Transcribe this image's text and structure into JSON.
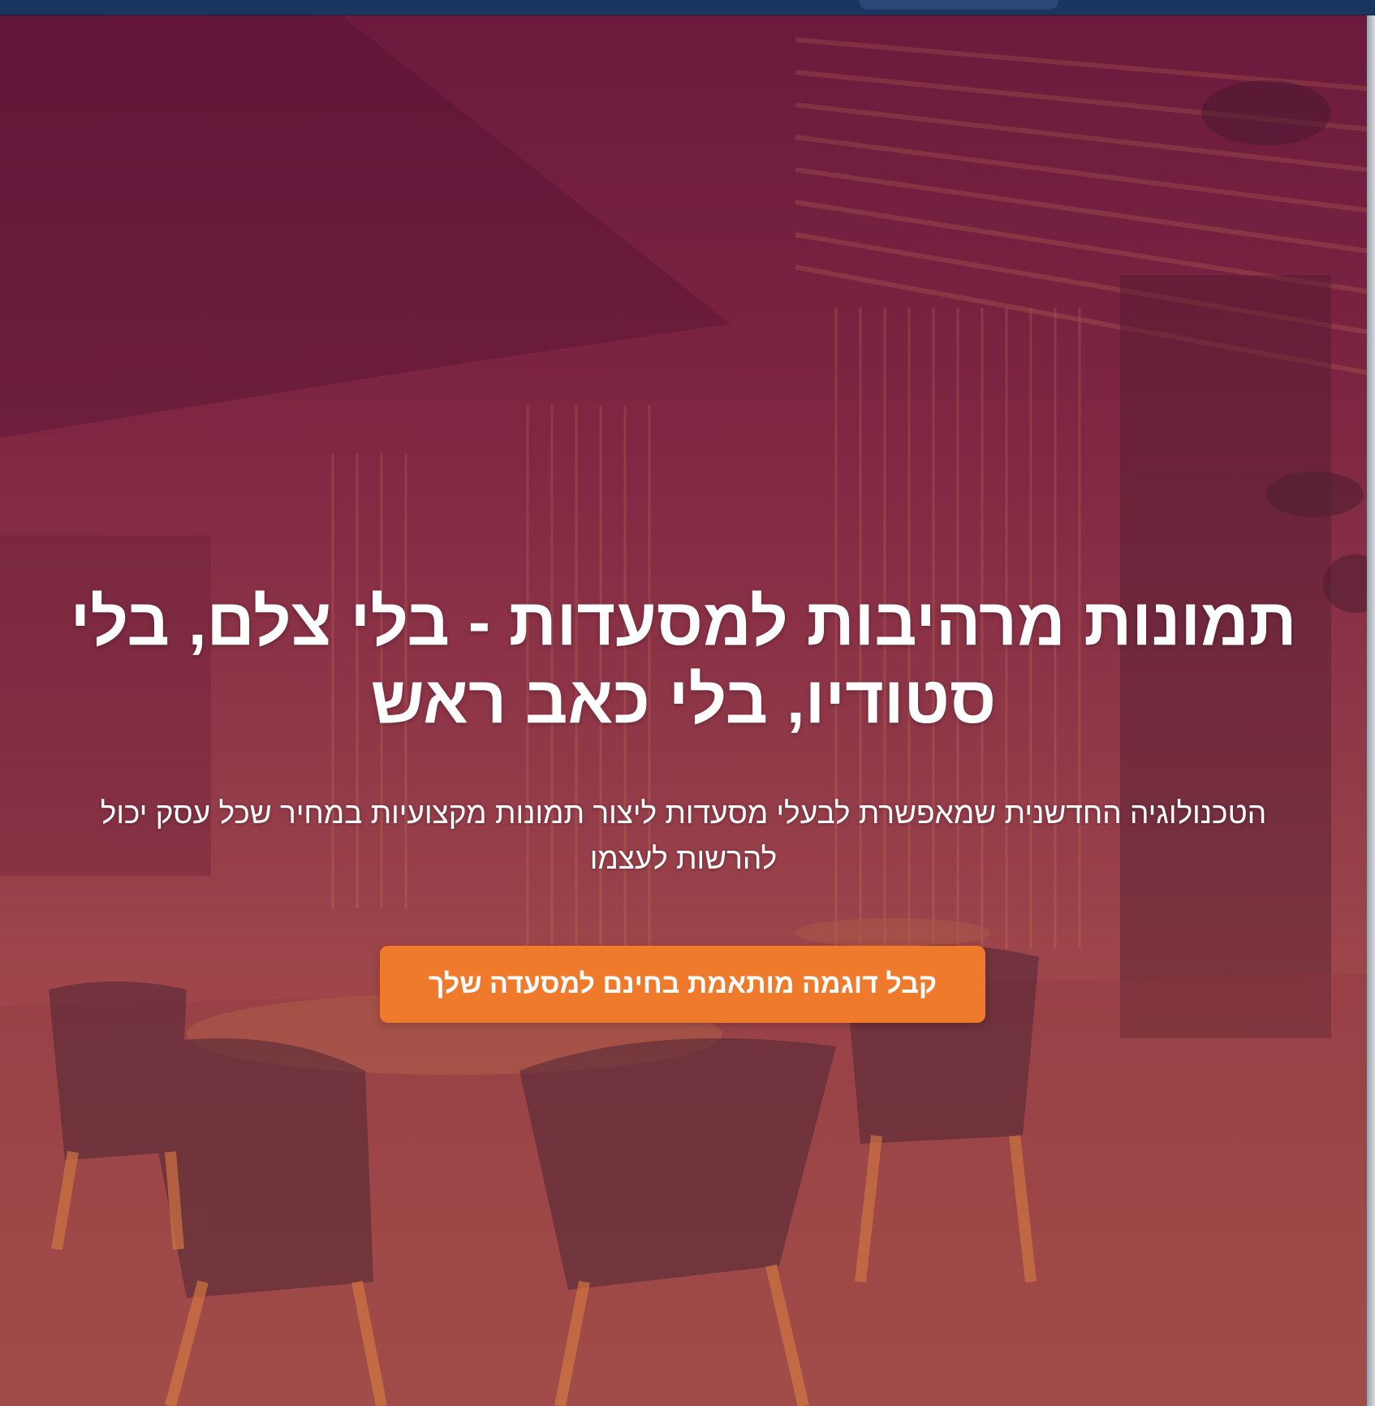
{
  "hero": {
    "headline": "תמונות מרהיבות למסעדות - בלי צלם, בלי סטודיו, בלי כאב ראש",
    "subtext": "הטכנולוגיה החדשנית שמאפשרת לבעלי מסעדות ליצור תמונות מקצועיות במחיר שכל עסק יכול להרשות לעצמו",
    "cta_label": "קבל דוגמה מותאמת בחינם למסעדה שלך"
  },
  "colors": {
    "topbar": "#1a3560",
    "overlay": "#7a2742",
    "cta": "#ef7a2c",
    "text": "#ffffff"
  }
}
